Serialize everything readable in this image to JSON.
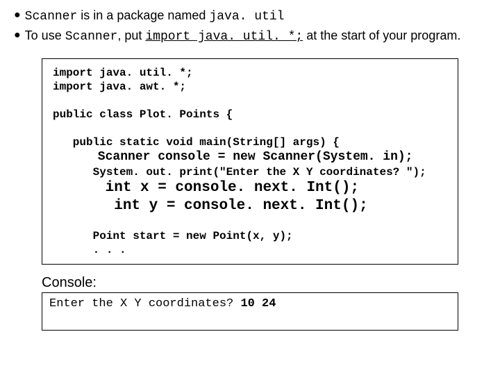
{
  "bullets": {
    "b1_scanner": "Scanner",
    "b1_mid": " is in a package named ",
    "b1_pkg": "java. util",
    "b2_pre": "To use ",
    "b2_scanner": "Scanner",
    "b2_mid": ", put  ",
    "b2_import": "import java. util. *;",
    "b2_post": "  at the start of your program."
  },
  "code": {
    "l1": "import java. util. *;",
    "l2": "import java. awt. *;",
    "l3": "",
    "l4": "public class Plot. Points {",
    "l5": "",
    "l6": "   public static void main(String[] args) {",
    "l7": "      Scanner console = new Scanner(System. in);",
    "l8": "      System. out. print(\"Enter the X Y coordinates? \");",
    "l9": "      int x = console. next. Int();",
    "l10": "       int y = console. next. Int();",
    "l11": "",
    "l12": "      Point start = new Point(x, y);",
    "l13": "      . . ."
  },
  "console": {
    "label": "Console:",
    "prompt": "Enter the X Y coordinates? ",
    "input": "10 24"
  }
}
